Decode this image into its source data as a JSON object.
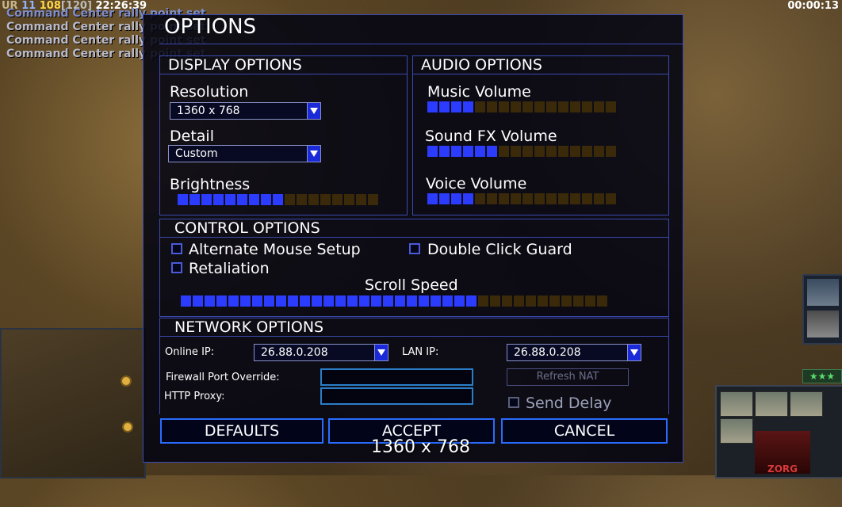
{
  "hud": {
    "ur": "UR",
    "count_a": "11",
    "count_b": "108",
    "count_c": "[120]",
    "clock": "22:26:39",
    "timer": "00:00:13",
    "messages": [
      "Command Center rally point set",
      "Command Center rally point set",
      "Command Center rally point set",
      "Command Center rally point set"
    ],
    "stars": "★★★",
    "faction_label": "ZORG"
  },
  "dialog": {
    "title": "OPTIONS",
    "display": {
      "heading": "DISPLAY OPTIONS",
      "resolution_label": "Resolution",
      "resolution_value": "1360 x 768",
      "detail_label": "Detail",
      "detail_value": "Custom",
      "brightness_label": "Brightness",
      "brightness_level": 0.55
    },
    "audio": {
      "heading": "AUDIO OPTIONS",
      "music_label": "Music Volume",
      "music_level": 0.25,
      "sfx_label": "Sound FX Volume",
      "sfx_level": 0.35,
      "voice_label": "Voice Volume",
      "voice_level": 0.25
    },
    "control": {
      "heading": "CONTROL OPTIONS",
      "alt_mouse_label": "Alternate Mouse Setup",
      "double_click_label": "Double Click Guard",
      "retaliation_label": "Retaliation",
      "scroll_label": "Scroll Speed",
      "scroll_level": 0.7
    },
    "network": {
      "heading": "NETWORK OPTIONS",
      "online_ip_label": "Online IP:",
      "online_ip_value": "26.88.0.208",
      "lan_ip_label": "LAN IP:",
      "lan_ip_value": "26.88.0.208",
      "firewall_label": "Firewall Port Override:",
      "firewall_value": "",
      "http_proxy_label": "HTTP Proxy:",
      "http_proxy_value": "",
      "refresh_nat_label": "Refresh NAT",
      "send_delay_label": "Send Delay"
    },
    "buttons": {
      "defaults": "DEFAULTS",
      "accept": "ACCEPT",
      "cancel": "CANCEL"
    },
    "tooltip": "1360 x 768"
  },
  "colors": {
    "accent": "#3b4ab0",
    "slider_on": "#2b3cff",
    "slider_off": "#3a2a0a",
    "button_border": "#2a6cff"
  }
}
